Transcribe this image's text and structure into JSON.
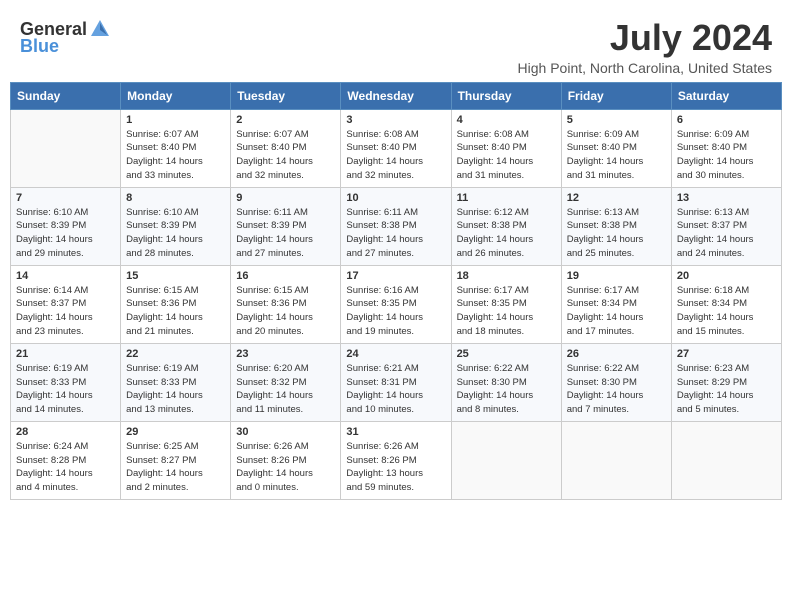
{
  "header": {
    "logo_general": "General",
    "logo_blue": "Blue",
    "title": "July 2024",
    "subtitle": "High Point, North Carolina, United States"
  },
  "calendar": {
    "days_of_week": [
      "Sunday",
      "Monday",
      "Tuesday",
      "Wednesday",
      "Thursday",
      "Friday",
      "Saturday"
    ],
    "weeks": [
      [
        {
          "day": "",
          "info": ""
        },
        {
          "day": "1",
          "info": "Sunrise: 6:07 AM\nSunset: 8:40 PM\nDaylight: 14 hours\nand 33 minutes."
        },
        {
          "day": "2",
          "info": "Sunrise: 6:07 AM\nSunset: 8:40 PM\nDaylight: 14 hours\nand 32 minutes."
        },
        {
          "day": "3",
          "info": "Sunrise: 6:08 AM\nSunset: 8:40 PM\nDaylight: 14 hours\nand 32 minutes."
        },
        {
          "day": "4",
          "info": "Sunrise: 6:08 AM\nSunset: 8:40 PM\nDaylight: 14 hours\nand 31 minutes."
        },
        {
          "day": "5",
          "info": "Sunrise: 6:09 AM\nSunset: 8:40 PM\nDaylight: 14 hours\nand 31 minutes."
        },
        {
          "day": "6",
          "info": "Sunrise: 6:09 AM\nSunset: 8:40 PM\nDaylight: 14 hours\nand 30 minutes."
        }
      ],
      [
        {
          "day": "7",
          "info": "Sunrise: 6:10 AM\nSunset: 8:39 PM\nDaylight: 14 hours\nand 29 minutes."
        },
        {
          "day": "8",
          "info": "Sunrise: 6:10 AM\nSunset: 8:39 PM\nDaylight: 14 hours\nand 28 minutes."
        },
        {
          "day": "9",
          "info": "Sunrise: 6:11 AM\nSunset: 8:39 PM\nDaylight: 14 hours\nand 27 minutes."
        },
        {
          "day": "10",
          "info": "Sunrise: 6:11 AM\nSunset: 8:38 PM\nDaylight: 14 hours\nand 27 minutes."
        },
        {
          "day": "11",
          "info": "Sunrise: 6:12 AM\nSunset: 8:38 PM\nDaylight: 14 hours\nand 26 minutes."
        },
        {
          "day": "12",
          "info": "Sunrise: 6:13 AM\nSunset: 8:38 PM\nDaylight: 14 hours\nand 25 minutes."
        },
        {
          "day": "13",
          "info": "Sunrise: 6:13 AM\nSunset: 8:37 PM\nDaylight: 14 hours\nand 24 minutes."
        }
      ],
      [
        {
          "day": "14",
          "info": "Sunrise: 6:14 AM\nSunset: 8:37 PM\nDaylight: 14 hours\nand 23 minutes."
        },
        {
          "day": "15",
          "info": "Sunrise: 6:15 AM\nSunset: 8:36 PM\nDaylight: 14 hours\nand 21 minutes."
        },
        {
          "day": "16",
          "info": "Sunrise: 6:15 AM\nSunset: 8:36 PM\nDaylight: 14 hours\nand 20 minutes."
        },
        {
          "day": "17",
          "info": "Sunrise: 6:16 AM\nSunset: 8:35 PM\nDaylight: 14 hours\nand 19 minutes."
        },
        {
          "day": "18",
          "info": "Sunrise: 6:17 AM\nSunset: 8:35 PM\nDaylight: 14 hours\nand 18 minutes."
        },
        {
          "day": "19",
          "info": "Sunrise: 6:17 AM\nSunset: 8:34 PM\nDaylight: 14 hours\nand 17 minutes."
        },
        {
          "day": "20",
          "info": "Sunrise: 6:18 AM\nSunset: 8:34 PM\nDaylight: 14 hours\nand 15 minutes."
        }
      ],
      [
        {
          "day": "21",
          "info": "Sunrise: 6:19 AM\nSunset: 8:33 PM\nDaylight: 14 hours\nand 14 minutes."
        },
        {
          "day": "22",
          "info": "Sunrise: 6:19 AM\nSunset: 8:33 PM\nDaylight: 14 hours\nand 13 minutes."
        },
        {
          "day": "23",
          "info": "Sunrise: 6:20 AM\nSunset: 8:32 PM\nDaylight: 14 hours\nand 11 minutes."
        },
        {
          "day": "24",
          "info": "Sunrise: 6:21 AM\nSunset: 8:31 PM\nDaylight: 14 hours\nand 10 minutes."
        },
        {
          "day": "25",
          "info": "Sunrise: 6:22 AM\nSunset: 8:30 PM\nDaylight: 14 hours\nand 8 minutes."
        },
        {
          "day": "26",
          "info": "Sunrise: 6:22 AM\nSunset: 8:30 PM\nDaylight: 14 hours\nand 7 minutes."
        },
        {
          "day": "27",
          "info": "Sunrise: 6:23 AM\nSunset: 8:29 PM\nDaylight: 14 hours\nand 5 minutes."
        }
      ],
      [
        {
          "day": "28",
          "info": "Sunrise: 6:24 AM\nSunset: 8:28 PM\nDaylight: 14 hours\nand 4 minutes."
        },
        {
          "day": "29",
          "info": "Sunrise: 6:25 AM\nSunset: 8:27 PM\nDaylight: 14 hours\nand 2 minutes."
        },
        {
          "day": "30",
          "info": "Sunrise: 6:26 AM\nSunset: 8:26 PM\nDaylight: 14 hours\nand 0 minutes."
        },
        {
          "day": "31",
          "info": "Sunrise: 6:26 AM\nSunset: 8:26 PM\nDaylight: 13 hours\nand 59 minutes."
        },
        {
          "day": "",
          "info": ""
        },
        {
          "day": "",
          "info": ""
        },
        {
          "day": "",
          "info": ""
        }
      ]
    ]
  }
}
